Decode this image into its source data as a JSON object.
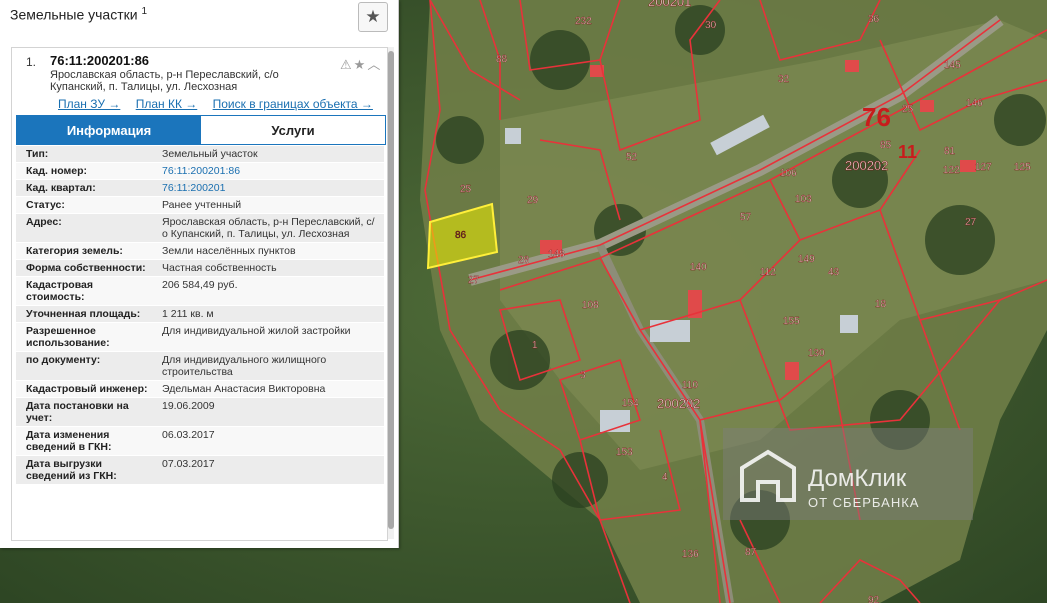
{
  "panel": {
    "title": "Земельные участки",
    "title_sup": "1",
    "favorite_icon": "star-icon"
  },
  "item": {
    "index": "1.",
    "cadastral_number": "76:11:200201:86",
    "address": "Ярославская область, р-н Переславский, с/о Купанский, п. Талицы, ул. Лесхозная",
    "icons": "⚠ ★ ︿",
    "links": [
      "План ЗУ →",
      "План КК →",
      "Поиск в границах объекта →"
    ]
  },
  "tabs": [
    "Информация",
    "Услуги"
  ],
  "rows": [
    {
      "label": "Тип:",
      "value": "Земельный участок"
    },
    {
      "label": "Кад. номер:",
      "value": "76:11:200201:86"
    },
    {
      "label": "Кад. квартал:",
      "value": "76:11:200201"
    },
    {
      "label": "Статус:",
      "value": "Ранее учтенный"
    },
    {
      "label": "Адрес:",
      "value": "Ярославская область, р-н Переславский, с/о Купанский, п. Талицы, ул. Лесхозная"
    },
    {
      "label": "Категория земель:",
      "value": "Земли населённых пунктов"
    },
    {
      "label": "Форма собственности:",
      "value": "Частная собственность"
    },
    {
      "label": "Кадастровая стоимость:",
      "value": "206 584,49 руб."
    },
    {
      "label": "Уточненная площадь:",
      "value": "1 211 кв. м"
    },
    {
      "label": "Разрешенное использование:",
      "value": "Для индивидуальной жилой застройки"
    },
    {
      "label": "по документу:",
      "value": "Для индивидуального жилищного строительства"
    },
    {
      "label": "Кадастровый инженер:",
      "value": "Эдельман Анастасия Викторовна"
    },
    {
      "label": "Дата постановки на учет:",
      "value": "19.06.2009"
    },
    {
      "label": "Дата изменения сведений в ГКН:",
      "value": "06.03.2017"
    },
    {
      "label": "Дата выгрузки сведений из ГКН:",
      "value": "07.03.2017"
    }
  ],
  "map": {
    "big_labels": [
      "76",
      "11"
    ],
    "quarter_labels": [
      "200201",
      "200202",
      "200202"
    ],
    "parcel_labels": [
      "88",
      "232",
      "30",
      "32",
      "36",
      "145",
      "146",
      "25",
      "85",
      "81",
      "122",
      "127",
      "125",
      "52",
      "57",
      "106",
      "103",
      "25",
      "29",
      "86",
      "28",
      "148",
      "27",
      "108",
      "1",
      "3",
      "155",
      "112",
      "18",
      "130",
      "149",
      "110",
      "154",
      "153",
      "4",
      "136",
      "87",
      "92",
      "27",
      "140",
      "43"
    ],
    "selected_parcel": "86",
    "watermark_line1": "ДомКлик",
    "watermark_line2": "ОТ СБЕРБАНКА"
  }
}
